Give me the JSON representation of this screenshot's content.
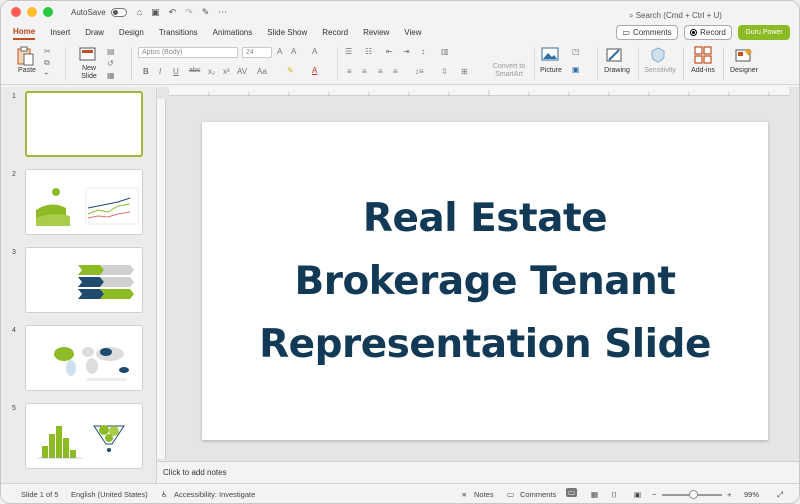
{
  "window": {
    "autosave_label": "AutoSave",
    "search_placeholder": "Search (Cmd + Ctrl + U)"
  },
  "tabs": [
    "Home",
    "Insert",
    "Draw",
    "Design",
    "Transitions",
    "Animations",
    "Slide Show",
    "Record",
    "Review",
    "View"
  ],
  "actions": {
    "comments": "Comments",
    "record": "Record",
    "guru": "Guru Power"
  },
  "ribbon": {
    "paste": "Paste",
    "new_slide_line1": "New",
    "new_slide_line2": "Slide",
    "font_name": "Aptos (Body)",
    "font_size": "24",
    "bold": "B",
    "italic": "I",
    "underline": "U",
    "strike": "abc",
    "convert_line1": "Convert to",
    "convert_line2": "SmartArt",
    "picture": "Picture",
    "drawing": "Drawing",
    "sensitivity": "Sensitivity",
    "addins": "Add-ins",
    "designer": "Designer"
  },
  "slides": {
    "numbers": [
      "1",
      "2",
      "3",
      "4",
      "5"
    ],
    "current_title_line1": "Real Estate",
    "current_title_line2": "Brokerage Tenant",
    "current_title_line3": "Representation Slide"
  },
  "notes": {
    "placeholder": "Click to add notes"
  },
  "status": {
    "slide_info": "Slide 1 of 5",
    "language": "English (United States)",
    "accessibility": "Accessibility: Investigate",
    "notes": "Notes",
    "comments": "Comments",
    "zoom": "99%"
  },
  "colors": {
    "accent_tab": "#c3501f",
    "title_color": "#123a57",
    "green": "#8dbb25",
    "navy": "#1e4b6e",
    "gray": "#cfcfcf"
  }
}
